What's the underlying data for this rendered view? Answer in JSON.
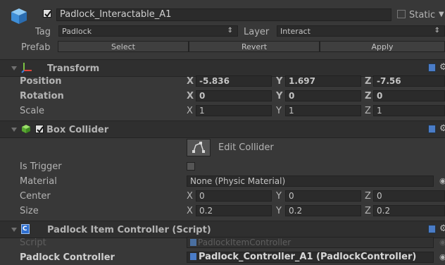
{
  "object": {
    "name": "Padlock_Interactable_A1",
    "active": true,
    "static_label": "Static",
    "tag_label": "Tag",
    "tag_value": "Padlock",
    "layer_label": "Layer",
    "layer_value": "Interact",
    "prefab_label": "Prefab",
    "prefab_select": "Select",
    "prefab_revert": "Revert",
    "prefab_apply": "Apply"
  },
  "transform": {
    "title": "Transform",
    "position": {
      "label": "Position",
      "x": "-5.836",
      "y": "1.697",
      "z": "-7.56"
    },
    "rotation": {
      "label": "Rotation",
      "x": "0",
      "y": "0",
      "z": "0"
    },
    "scale": {
      "label": "Scale",
      "x": "1",
      "y": "1",
      "z": "1"
    }
  },
  "box_collider": {
    "title": "Box Collider",
    "enabled": true,
    "edit_button": "Edit Collider",
    "is_trigger_label": "Is Trigger",
    "is_trigger": false,
    "material_label": "Material",
    "material_value": "None (Physic Material)",
    "center": {
      "label": "Center",
      "x": "0",
      "y": "0",
      "z": "0"
    },
    "size": {
      "label": "Size",
      "x": "0.2",
      "y": "0.2",
      "z": "0.2"
    }
  },
  "script_component": {
    "title": "Padlock Item Controller (Script)",
    "script_label": "Script",
    "script_value": "PadlockItemController",
    "controller_label": "Padlock Controller",
    "controller_value": "Padlock_Controller_A1 (PadlockController)"
  },
  "axes": {
    "x": "X",
    "y": "Y",
    "z": "Z"
  },
  "colors": {
    "background": "#383838",
    "header": "#2f2f2f",
    "field": "#2b2b2b",
    "cube": "#3f8fd8",
    "script_icon": "#2f6fd0"
  }
}
